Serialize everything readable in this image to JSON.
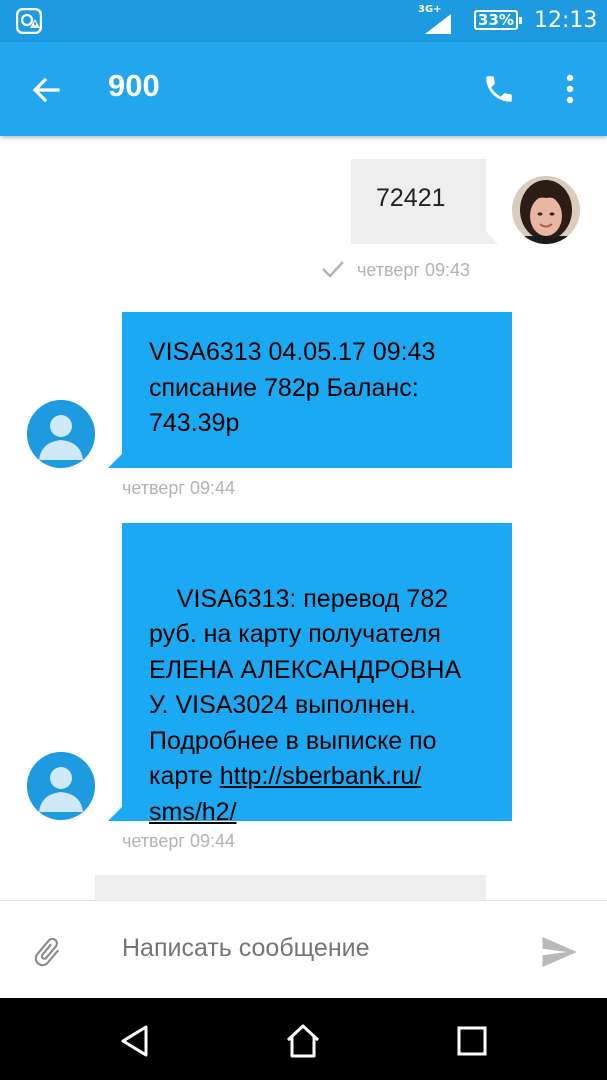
{
  "status_bar": {
    "network": "3G+",
    "battery": "33%",
    "time": "12:13"
  },
  "header": {
    "title": "900",
    "icons": [
      "back-arrow-icon",
      "phone-icon",
      "more-vert-icon"
    ]
  },
  "messages": [
    {
      "direction": "outgoing",
      "text": "72421",
      "time": "четверг 09:43",
      "status_icon": "check-icon"
    },
    {
      "direction": "incoming",
      "text": "VISA6313 04.05.17 09:43\nсписание 782р Баланс:\n743.39р",
      "time": "четверг 09:44"
    },
    {
      "direction": "incoming",
      "text_before_link": "VISA6313: перевод 782\nруб. на карту получателя\nЕЛЕНА АЛЕКСАНДРОВНА\nУ. VISA3024 выполнен.\nПодробнее в выписке по\nкарте ",
      "link_line1": "http://sberbank.ru/",
      "link_line2": "sms/h2/",
      "time": "четверг 09:44"
    }
  ],
  "composer": {
    "placeholder": "Написать сообщение",
    "icons": [
      "paperclip-icon",
      "send-icon"
    ]
  },
  "colors": {
    "status_bar": "#1e9be0",
    "app_bar": "#22a6ee",
    "incoming_bubble": "#1aa9f2",
    "outgoing_bubble": "#eeeeee"
  },
  "navigation": [
    "back-nav-icon",
    "home-nav-icon",
    "recents-nav-icon"
  ]
}
